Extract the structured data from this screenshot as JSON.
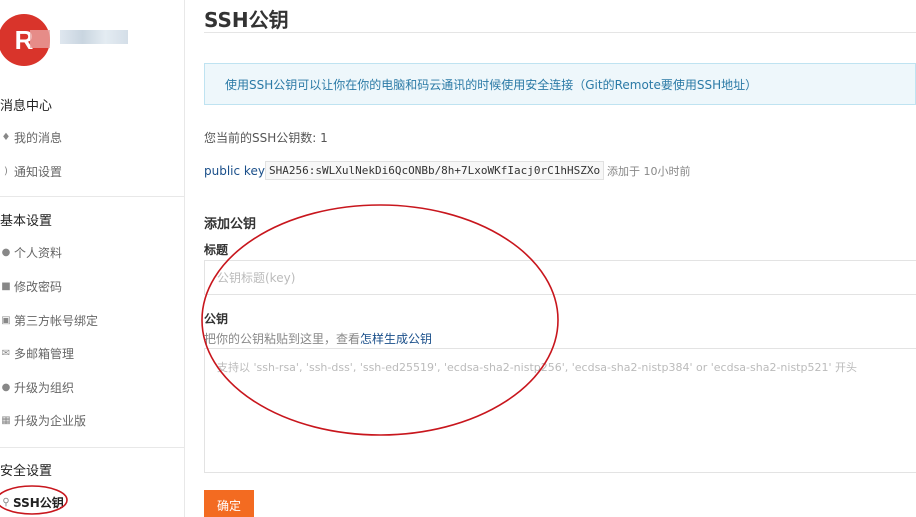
{
  "user": {
    "avatar_letter": "R"
  },
  "sidebar": {
    "groups": [
      {
        "title": "消息中心",
        "items": [
          {
            "label": "我的消息",
            "icon": "bell-icon"
          },
          {
            "label": "通知设置",
            "icon": "speaker-icon"
          }
        ]
      },
      {
        "title": "基本设置",
        "items": [
          {
            "label": "个人资料",
            "icon": "user-icon"
          },
          {
            "label": "修改密码",
            "icon": "lock-icon"
          },
          {
            "label": "第三方帐号绑定",
            "icon": "link-icon"
          },
          {
            "label": "多邮箱管理",
            "icon": "envelope-icon"
          },
          {
            "label": "升级为组织",
            "icon": "group-icon"
          },
          {
            "label": "升级为企业版",
            "icon": "building-icon"
          }
        ]
      },
      {
        "title": "安全设置",
        "items": [
          {
            "label": "SSH公钥",
            "icon": "key-icon",
            "active": true
          }
        ]
      }
    ]
  },
  "main": {
    "page_title": "SSH公钥",
    "info_text": "使用SSH公钥可以让你在你的电脑和码云通讯的时候使用安全连接（Git的Remote要使用SSH地址）",
    "count_text": "您当前的SSH公钥数: 1",
    "keys": [
      {
        "label": "public key",
        "fingerprint": "SHA256:sWLXulNekDi6QcONBb/8h+7LxoWKfIacj0rC1hHSZXo",
        "added": "添加于 10小时前"
      }
    ],
    "add_form": {
      "heading": "添加公钥",
      "title_label": "标题",
      "title_placeholder": "公钥标题(key)",
      "key_label": "公钥",
      "key_hint": "把你的公钥粘贴到这里，查看",
      "key_hint_link": "怎样生成公钥",
      "key_placeholder": "支持以 'ssh-rsa', 'ssh-dss', 'ssh-ed25519', 'ecdsa-sha2-nistp256', 'ecdsa-sha2-nistp384' or 'ecdsa-sha2-nistp521' 开头",
      "submit_label": "确定"
    }
  },
  "colors": {
    "accent": "#f36b21",
    "annotation": "#c8161d",
    "info_bg": "#eef7fb",
    "link": "#1a4f8a"
  }
}
